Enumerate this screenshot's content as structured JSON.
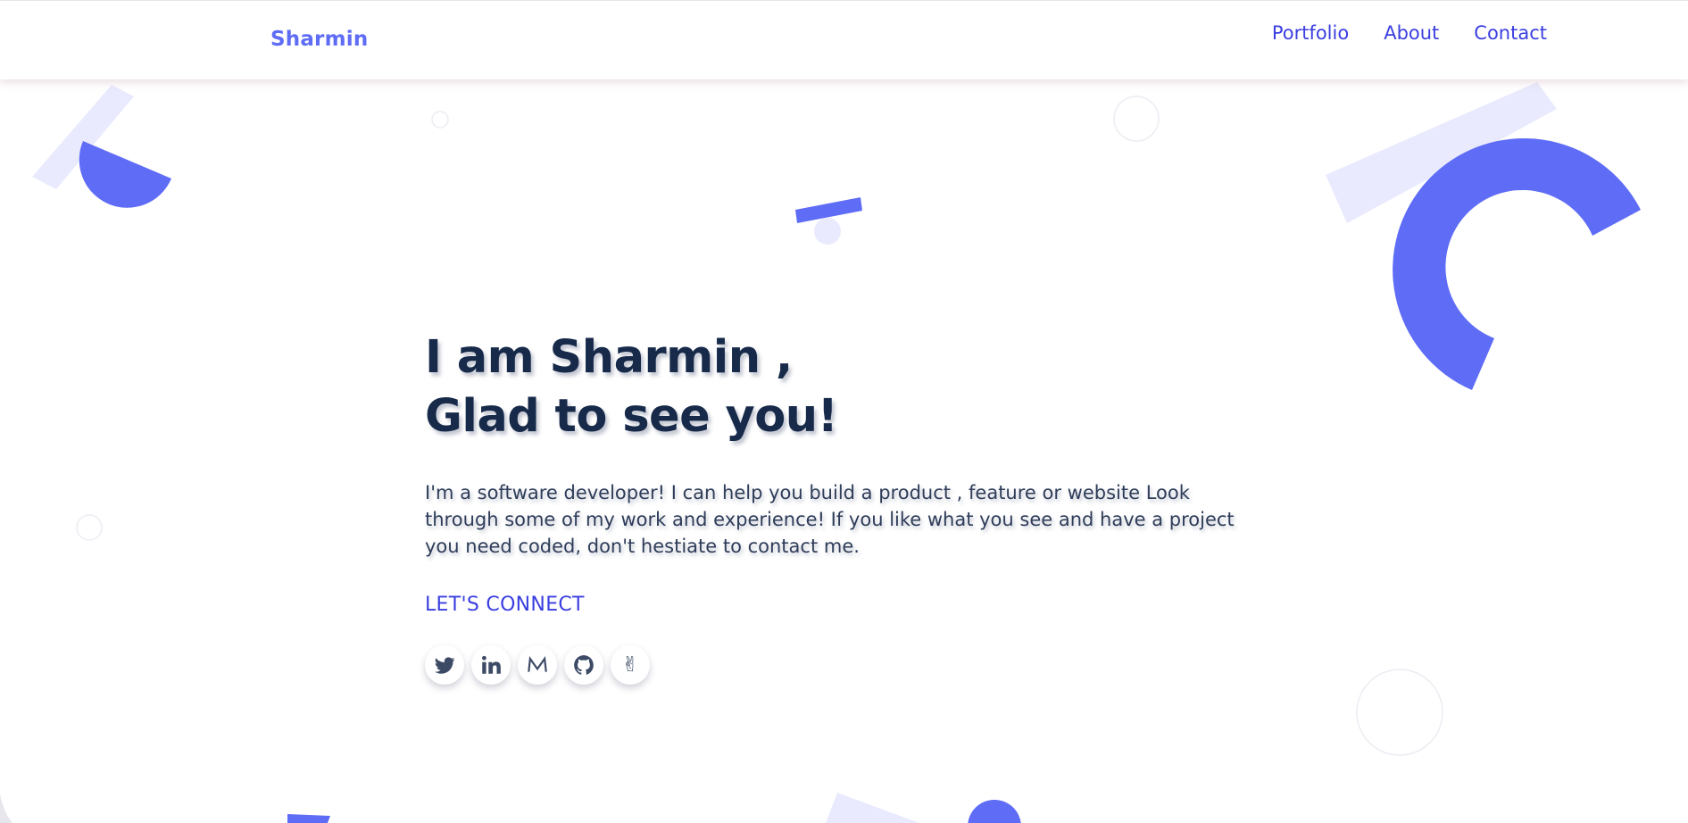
{
  "nav": {
    "brand": "Sharmin",
    "links": [
      "Portfolio",
      "About",
      "Contact"
    ]
  },
  "hero": {
    "headline_line1": "I am Sharmin ,",
    "headline_line2": "Glad to see you!",
    "intro": "I'm a software developer! I can help you build a product , feature or website Look through some of my work and experience! If you like what you see and have a project you need coded, don't hestiate to contact me.",
    "connect_label": "LET'S CONNECT"
  },
  "socials": [
    {
      "icon": "twitter-icon"
    },
    {
      "icon": "linkedin-icon"
    },
    {
      "icon": "medium-icon"
    },
    {
      "icon": "github-icon"
    },
    {
      "icon": "angellist-icon"
    }
  ],
  "colors": {
    "accent": "#5e6cf6",
    "accent_light": "#e9eafd",
    "link": "#3a3fe0",
    "heading": "#172a4a",
    "body_text": "#2f3d5a"
  }
}
